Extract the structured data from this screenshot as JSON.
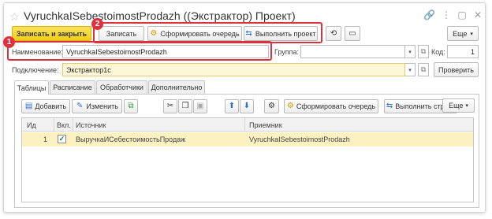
{
  "window": {
    "title": "VyruchkaISebestoimostProdazh ((Экстрактор) Проект)",
    "star_icon": "star-icon",
    "controls": [
      "link-icon",
      "more-icon",
      "minimize-icon",
      "close-icon"
    ]
  },
  "toolbar": {
    "save_close_label": "Записать и закрыть",
    "save_label": "Записать",
    "form_queue_label": "Сформировать очередь",
    "run_project_label": "Выполнить проект",
    "more_label": "Еще"
  },
  "badges": {
    "one": "1",
    "two": "2"
  },
  "form": {
    "name_label": "Наименование:",
    "name_value": "VyruchkaISebestoimostProdazh",
    "group_label": "Группа:",
    "group_value": "",
    "code_label": "Код:",
    "code_value": "1",
    "connection_label": "Подключение:",
    "connection_value": "Экстрактор1с",
    "check_label": "Проверить"
  },
  "tabs": [
    "Таблицы",
    "Расписание",
    "Обработчики",
    "Дополнительно"
  ],
  "table_toolbar": {
    "add_label": "Добавить",
    "edit_label": "Изменить",
    "form_queue_label": "Сформировать очередь",
    "run_row_label": "Выполнить строку",
    "more_label": "Еще"
  },
  "grid": {
    "headers": [
      "Ид",
      "Вкл.",
      "Источник",
      "Приемник"
    ],
    "rows": [
      {
        "id": "1",
        "enabled": "✓",
        "source": "ВыручкаИСебестоимостьПродаж",
        "target": "VyruchkaISebestoimostProdazh"
      }
    ]
  },
  "colors": {
    "accent_yellow": "#f2cd1a",
    "highlight_red": "#e0303d",
    "selected_row": "#fbf1c1"
  }
}
